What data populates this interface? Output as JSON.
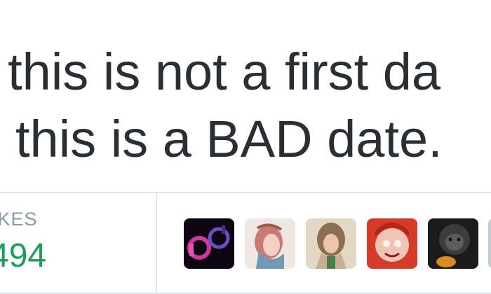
{
  "tweet": {
    "text_line_1": "t this is not a first da",
    "text_line_2": "this is a BAD date."
  },
  "stats": {
    "likes_label": "IKES",
    "likes_count": "494"
  },
  "avatars": [
    {
      "name": "avatar-1",
      "colors": [
        "#0d0612",
        "#d1389c",
        "#4a2c8a"
      ]
    },
    {
      "name": "avatar-2",
      "colors": [
        "#efe7e1",
        "#c97a72",
        "#6f99b5"
      ]
    },
    {
      "name": "avatar-3",
      "colors": [
        "#e3d8c6",
        "#8d6e4f",
        "#4d7d4b"
      ]
    },
    {
      "name": "avatar-4",
      "colors": [
        "#d63a28",
        "#f0c5b8",
        "#fff3ea"
      ]
    },
    {
      "name": "avatar-5",
      "colors": [
        "#1b1b1b",
        "#5d5d5d",
        "#d98b22"
      ]
    },
    {
      "name": "avatar-6",
      "colors": [
        "#e1e8ed",
        "#c3ccd3",
        "#9aa7b0"
      ]
    }
  ],
  "colors": {
    "text": "#292f33",
    "muted": "#8899a6",
    "likes": "#19a05a",
    "divider": "#e1e8ed"
  }
}
